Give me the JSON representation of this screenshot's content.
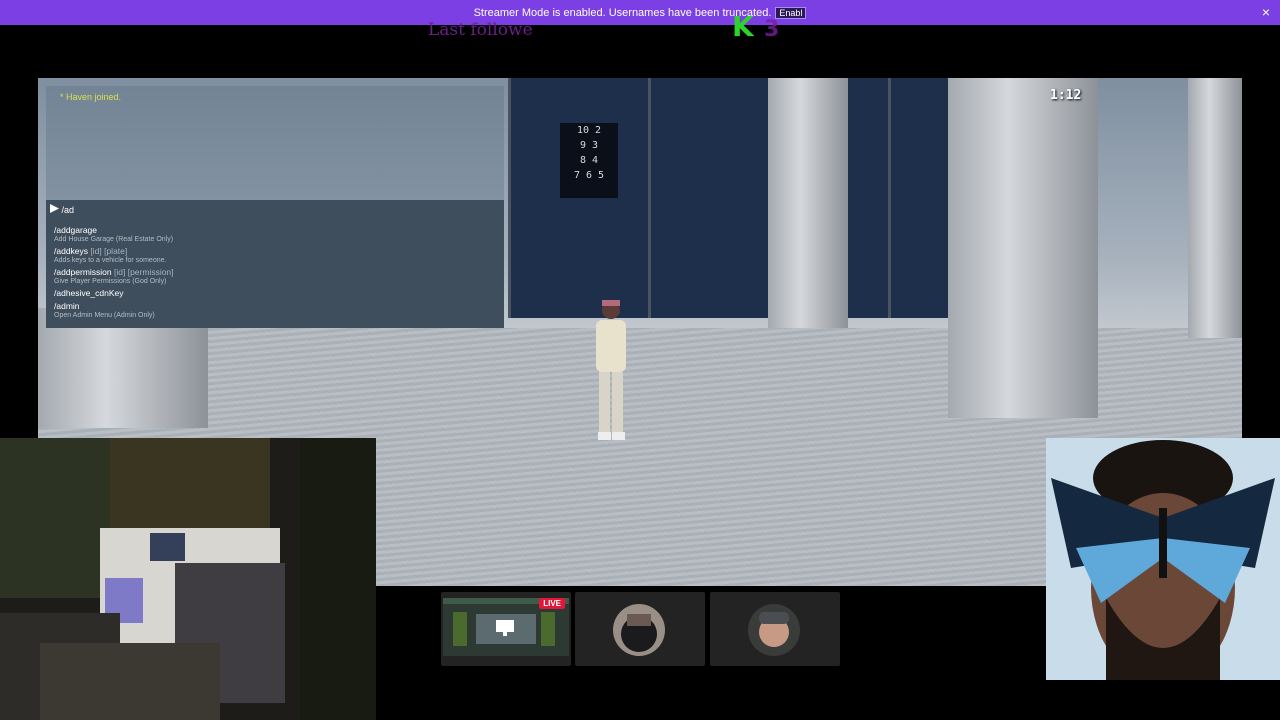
{
  "banner": {
    "text": "Streamer Mode is enabled. Usernames have been truncated.",
    "badge": "Enabl",
    "close_symbol": "×",
    "color": "#7b3fe4"
  },
  "overlay": {
    "last_follower": "Last followe",
    "logo_letter": "K",
    "logo_color": "#2fd12f"
  },
  "game": {
    "timer": "1:12",
    "clock_rows": [
      "10  2",
      "9  3",
      "8  4",
      "7 6 5"
    ],
    "chat": {
      "message": "* Haven joined."
    },
    "command_input": "/ad",
    "commands": [
      {
        "name": "/addgarage",
        "args": "",
        "desc": "Add House Garage (Real Estate Only)"
      },
      {
        "name": "/addkeys",
        "args": " [id] [plate]",
        "desc": "Adds keys to a vehicle for someone."
      },
      {
        "name": "/addpermission",
        "args": " [id] [permission]",
        "desc": "Give Player Permissions (God Only)"
      },
      {
        "name": "/adhesive_cdnKey",
        "args": "",
        "desc": ""
      },
      {
        "name": "/admin",
        "args": "",
        "desc": "Open Admin Menu (Admin Only)"
      }
    ]
  },
  "stream": {
    "live_label": "LIVE",
    "live_color": "#e0193b"
  },
  "icons": [
    "close-icon",
    "play-arrow-icon",
    "monitor-icon"
  ]
}
